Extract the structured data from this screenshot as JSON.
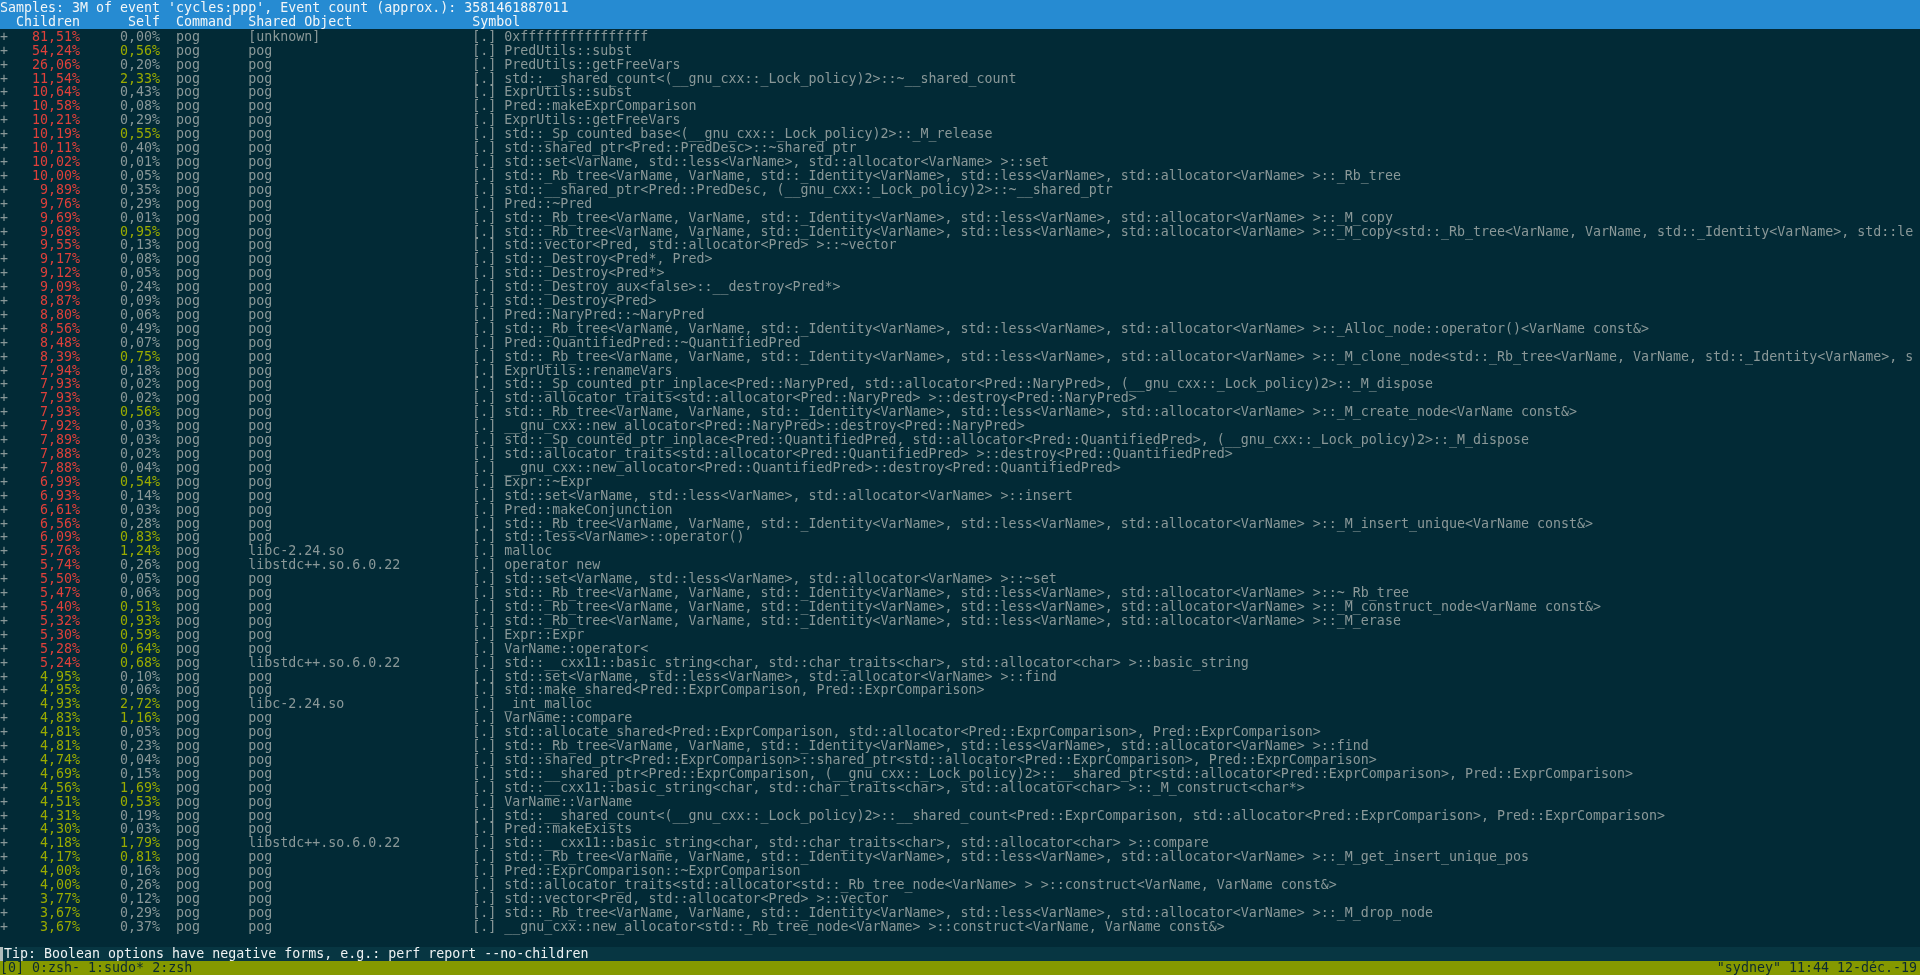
{
  "header": {
    "title": "Samples: 3M of event 'cycles:ppp', Event count (approx.): 3581461887011",
    "columns": [
      "Children",
      "Self",
      "Command",
      "Shared Object",
      "Symbol"
    ]
  },
  "rows": [
    {
      "toggle": "+",
      "children": {
        "text": "81,51%",
        "color": "#e0403a"
      },
      "self": {
        "text": "0,00%",
        "color": "#8a9898"
      },
      "command": "pog",
      "object": "[unknown]",
      "mode": "[.]",
      "symbol": "0xffffffffffffffff"
    },
    {
      "toggle": "+",
      "children": {
        "text": "54,24%",
        "color": "#e0403a"
      },
      "self": {
        "text": "0,56%",
        "color": "#9aab00"
      },
      "command": "pog",
      "object": "pog",
      "mode": "[.]",
      "symbol": "PredUtils::subst"
    },
    {
      "toggle": "+",
      "children": {
        "text": "26,06%",
        "color": "#e0403a"
      },
      "self": {
        "text": "0,20%",
        "color": "#8a9898"
      },
      "command": "pog",
      "object": "pog",
      "mode": "[.]",
      "symbol": "PredUtils::getFreeVars"
    },
    {
      "toggle": "+",
      "children": {
        "text": "11,54%",
        "color": "#e0403a"
      },
      "self": {
        "text": "2,33%",
        "color": "#9aab00"
      },
      "command": "pog",
      "object": "pog",
      "mode": "[.]",
      "symbol": "std::__shared_count<(__gnu_cxx::_Lock_policy)2>::~__shared_count"
    },
    {
      "toggle": "+",
      "children": {
        "text": "10,64%",
        "color": "#e0403a"
      },
      "self": {
        "text": "0,43%",
        "color": "#8a9898"
      },
      "command": "pog",
      "object": "pog",
      "mode": "[.]",
      "symbol": "ExprUtils::subst"
    },
    {
      "toggle": "+",
      "children": {
        "text": "10,58%",
        "color": "#e0403a"
      },
      "self": {
        "text": "0,08%",
        "color": "#8a9898"
      },
      "command": "pog",
      "object": "pog",
      "mode": "[.]",
      "symbol": "Pred::makeExprComparison"
    },
    {
      "toggle": "+",
      "children": {
        "text": "10,21%",
        "color": "#e0403a"
      },
      "self": {
        "text": "0,29%",
        "color": "#8a9898"
      },
      "command": "pog",
      "object": "pog",
      "mode": "[.]",
      "symbol": "ExprUtils::getFreeVars"
    },
    {
      "toggle": "+",
      "children": {
        "text": "10,19%",
        "color": "#e0403a"
      },
      "self": {
        "text": "0,55%",
        "color": "#9aab00"
      },
      "command": "pog",
      "object": "pog",
      "mode": "[.]",
      "symbol": "std::_Sp_counted_base<(__gnu_cxx::_Lock_policy)2>::_M_release"
    },
    {
      "toggle": "+",
      "children": {
        "text": "10,11%",
        "color": "#e0403a"
      },
      "self": {
        "text": "0,40%",
        "color": "#8a9898"
      },
      "command": "pog",
      "object": "pog",
      "mode": "[.]",
      "symbol": "std::shared_ptr<Pred::PredDesc>::~shared_ptr"
    },
    {
      "toggle": "+",
      "children": {
        "text": "10,02%",
        "color": "#e0403a"
      },
      "self": {
        "text": "0,01%",
        "color": "#8a9898"
      },
      "command": "pog",
      "object": "pog",
      "mode": "[.]",
      "symbol": "std::set<VarName, std::less<VarName>, std::allocator<VarName> >::set"
    },
    {
      "toggle": "+",
      "children": {
        "text": "10,00%",
        "color": "#e0403a"
      },
      "self": {
        "text": "0,05%",
        "color": "#8a9898"
      },
      "command": "pog",
      "object": "pog",
      "mode": "[.]",
      "symbol": "std::_Rb_tree<VarName, VarName, std::_Identity<VarName>, std::less<VarName>, std::allocator<VarName> >::_Rb_tree"
    },
    {
      "toggle": "+",
      "children": {
        "text": "9,89%",
        "color": "#e0403a"
      },
      "self": {
        "text": "0,35%",
        "color": "#8a9898"
      },
      "command": "pog",
      "object": "pog",
      "mode": "[.]",
      "symbol": "std::__shared_ptr<Pred::PredDesc, (__gnu_cxx::_Lock_policy)2>::~__shared_ptr"
    },
    {
      "toggle": "+",
      "children": {
        "text": "9,76%",
        "color": "#e0403a"
      },
      "self": {
        "text": "0,29%",
        "color": "#8a9898"
      },
      "command": "pog",
      "object": "pog",
      "mode": "[.]",
      "symbol": "Pred::~Pred"
    },
    {
      "toggle": "+",
      "children": {
        "text": "9,69%",
        "color": "#e0403a"
      },
      "self": {
        "text": "0,01%",
        "color": "#8a9898"
      },
      "command": "pog",
      "object": "pog",
      "mode": "[.]",
      "symbol": "std::_Rb_tree<VarName, VarName, std::_Identity<VarName>, std::less<VarName>, std::allocator<VarName> >::_M_copy"
    },
    {
      "toggle": "+",
      "children": {
        "text": "9,68%",
        "color": "#e0403a"
      },
      "self": {
        "text": "0,95%",
        "color": "#9aab00"
      },
      "command": "pog",
      "object": "pog",
      "mode": "[.]",
      "symbol": "std::_Rb_tree<VarName, VarName, std::_Identity<VarName>, std::less<VarName>, std::allocator<VarName> >::_M_copy<std::_Rb_tree<VarName, VarName, std::_Identity<VarName>, std::le"
    },
    {
      "toggle": "+",
      "children": {
        "text": "9,55%",
        "color": "#e0403a"
      },
      "self": {
        "text": "0,13%",
        "color": "#8a9898"
      },
      "command": "pog",
      "object": "pog",
      "mode": "[.]",
      "symbol": "std::vector<Pred, std::allocator<Pred> >::~vector"
    },
    {
      "toggle": "+",
      "children": {
        "text": "9,17%",
        "color": "#e0403a"
      },
      "self": {
        "text": "0,08%",
        "color": "#8a9898"
      },
      "command": "pog",
      "object": "pog",
      "mode": "[.]",
      "symbol": "std::_Destroy<Pred*, Pred>"
    },
    {
      "toggle": "+",
      "children": {
        "text": "9,12%",
        "color": "#e0403a"
      },
      "self": {
        "text": "0,05%",
        "color": "#8a9898"
      },
      "command": "pog",
      "object": "pog",
      "mode": "[.]",
      "symbol": "std::_Destroy<Pred*>"
    },
    {
      "toggle": "+",
      "children": {
        "text": "9,09%",
        "color": "#e0403a"
      },
      "self": {
        "text": "0,24%",
        "color": "#8a9898"
      },
      "command": "pog",
      "object": "pog",
      "mode": "[.]",
      "symbol": "std::_Destroy_aux<false>::__destroy<Pred*>"
    },
    {
      "toggle": "+",
      "children": {
        "text": "8,87%",
        "color": "#e0403a"
      },
      "self": {
        "text": "0,09%",
        "color": "#8a9898"
      },
      "command": "pog",
      "object": "pog",
      "mode": "[.]",
      "symbol": "std::_Destroy<Pred>"
    },
    {
      "toggle": "+",
      "children": {
        "text": "8,80%",
        "color": "#e0403a"
      },
      "self": {
        "text": "0,06%",
        "color": "#8a9898"
      },
      "command": "pog",
      "object": "pog",
      "mode": "[.]",
      "symbol": "Pred::NaryPred::~NaryPred"
    },
    {
      "toggle": "+",
      "children": {
        "text": "8,56%",
        "color": "#e0403a"
      },
      "self": {
        "text": "0,49%",
        "color": "#8a9898"
      },
      "command": "pog",
      "object": "pog",
      "mode": "[.]",
      "symbol": "std::_Rb_tree<VarName, VarName, std::_Identity<VarName>, std::less<VarName>, std::allocator<VarName> >::_Alloc_node::operator()<VarName const&>"
    },
    {
      "toggle": "+",
      "children": {
        "text": "8,48%",
        "color": "#e0403a"
      },
      "self": {
        "text": "0,07%",
        "color": "#8a9898"
      },
      "command": "pog",
      "object": "pog",
      "mode": "[.]",
      "symbol": "Pred::QuantifiedPred::~QuantifiedPred"
    },
    {
      "toggle": "+",
      "children": {
        "text": "8,39%",
        "color": "#e0403a"
      },
      "self": {
        "text": "0,75%",
        "color": "#9aab00"
      },
      "command": "pog",
      "object": "pog",
      "mode": "[.]",
      "symbol": "std::_Rb_tree<VarName, VarName, std::_Identity<VarName>, std::less<VarName>, std::allocator<VarName> >::_M_clone_node<std::_Rb_tree<VarName, VarName, std::_Identity<VarName>, s"
    },
    {
      "toggle": "+",
      "children": {
        "text": "7,94%",
        "color": "#e0403a"
      },
      "self": {
        "text": "0,18%",
        "color": "#8a9898"
      },
      "command": "pog",
      "object": "pog",
      "mode": "[.]",
      "symbol": "ExprUtils::renameVars"
    },
    {
      "toggle": "+",
      "children": {
        "text": "7,93%",
        "color": "#e0403a"
      },
      "self": {
        "text": "0,02%",
        "color": "#8a9898"
      },
      "command": "pog",
      "object": "pog",
      "mode": "[.]",
      "symbol": "std::_Sp_counted_ptr_inplace<Pred::NaryPred, std::allocator<Pred::NaryPred>, (__gnu_cxx::_Lock_policy)2>::_M_dispose"
    },
    {
      "toggle": "+",
      "children": {
        "text": "7,93%",
        "color": "#e0403a"
      },
      "self": {
        "text": "0,02%",
        "color": "#8a9898"
      },
      "command": "pog",
      "object": "pog",
      "mode": "[.]",
      "symbol": "std::allocator_traits<std::allocator<Pred::NaryPred> >::destroy<Pred::NaryPred>"
    },
    {
      "toggle": "+",
      "children": {
        "text": "7,93%",
        "color": "#e0403a"
      },
      "self": {
        "text": "0,56%",
        "color": "#9aab00"
      },
      "command": "pog",
      "object": "pog",
      "mode": "[.]",
      "symbol": "std::_Rb_tree<VarName, VarName, std::_Identity<VarName>, std::less<VarName>, std::allocator<VarName> >::_M_create_node<VarName const&>"
    },
    {
      "toggle": "+",
      "children": {
        "text": "7,92%",
        "color": "#e0403a"
      },
      "self": {
        "text": "0,03%",
        "color": "#8a9898"
      },
      "command": "pog",
      "object": "pog",
      "mode": "[.]",
      "symbol": "__gnu_cxx::new_allocator<Pred::NaryPred>::destroy<Pred::NaryPred>"
    },
    {
      "toggle": "+",
      "children": {
        "text": "7,89%",
        "color": "#e0403a"
      },
      "self": {
        "text": "0,03%",
        "color": "#8a9898"
      },
      "command": "pog",
      "object": "pog",
      "mode": "[.]",
      "symbol": "std::_Sp_counted_ptr_inplace<Pred::QuantifiedPred, std::allocator<Pred::QuantifiedPred>, (__gnu_cxx::_Lock_policy)2>::_M_dispose"
    },
    {
      "toggle": "+",
      "children": {
        "text": "7,88%",
        "color": "#e0403a"
      },
      "self": {
        "text": "0,02%",
        "color": "#8a9898"
      },
      "command": "pog",
      "object": "pog",
      "mode": "[.]",
      "symbol": "std::allocator_traits<std::allocator<Pred::QuantifiedPred> >::destroy<Pred::QuantifiedPred>"
    },
    {
      "toggle": "+",
      "children": {
        "text": "7,88%",
        "color": "#e0403a"
      },
      "self": {
        "text": "0,04%",
        "color": "#8a9898"
      },
      "command": "pog",
      "object": "pog",
      "mode": "[.]",
      "symbol": "__gnu_cxx::new_allocator<Pred::QuantifiedPred>::destroy<Pred::QuantifiedPred>"
    },
    {
      "toggle": "+",
      "children": {
        "text": "6,99%",
        "color": "#e0403a"
      },
      "self": {
        "text": "0,54%",
        "color": "#9aab00"
      },
      "command": "pog",
      "object": "pog",
      "mode": "[.]",
      "symbol": "Expr::~Expr"
    },
    {
      "toggle": "+",
      "children": {
        "text": "6,93%",
        "color": "#e0403a"
      },
      "self": {
        "text": "0,14%",
        "color": "#8a9898"
      },
      "command": "pog",
      "object": "pog",
      "mode": "[.]",
      "symbol": "std::set<VarName, std::less<VarName>, std::allocator<VarName> >::insert"
    },
    {
      "toggle": "+",
      "children": {
        "text": "6,61%",
        "color": "#e0403a"
      },
      "self": {
        "text": "0,03%",
        "color": "#8a9898"
      },
      "command": "pog",
      "object": "pog",
      "mode": "[.]",
      "symbol": "Pred::makeConjunction"
    },
    {
      "toggle": "+",
      "children": {
        "text": "6,56%",
        "color": "#e0403a"
      },
      "self": {
        "text": "0,28%",
        "color": "#8a9898"
      },
      "command": "pog",
      "object": "pog",
      "mode": "[.]",
      "symbol": "std::_Rb_tree<VarName, VarName, std::_Identity<VarName>, std::less<VarName>, std::allocator<VarName> >::_M_insert_unique<VarName const&>"
    },
    {
      "toggle": "+",
      "children": {
        "text": "6,09%",
        "color": "#e0403a"
      },
      "self": {
        "text": "0,83%",
        "color": "#9aab00"
      },
      "command": "pog",
      "object": "pog",
      "mode": "[.]",
      "symbol": "std::less<VarName>::operator()"
    },
    {
      "toggle": "+",
      "children": {
        "text": "5,76%",
        "color": "#e0403a"
      },
      "self": {
        "text": "1,24%",
        "color": "#9aab00"
      },
      "command": "pog",
      "object": "libc-2.24.so",
      "mode": "[.]",
      "symbol": "malloc"
    },
    {
      "toggle": "+",
      "children": {
        "text": "5,74%",
        "color": "#e0403a"
      },
      "self": {
        "text": "0,26%",
        "color": "#8a9898"
      },
      "command": "pog",
      "object": "libstdc++.so.6.0.22",
      "mode": "[.]",
      "symbol": "operator new"
    },
    {
      "toggle": "+",
      "children": {
        "text": "5,50%",
        "color": "#e0403a"
      },
      "self": {
        "text": "0,05%",
        "color": "#8a9898"
      },
      "command": "pog",
      "object": "pog",
      "mode": "[.]",
      "symbol": "std::set<VarName, std::less<VarName>, std::allocator<VarName> >::~set"
    },
    {
      "toggle": "+",
      "children": {
        "text": "5,47%",
        "color": "#e0403a"
      },
      "self": {
        "text": "0,06%",
        "color": "#8a9898"
      },
      "command": "pog",
      "object": "pog",
      "mode": "[.]",
      "symbol": "std::_Rb_tree<VarName, VarName, std::_Identity<VarName>, std::less<VarName>, std::allocator<VarName> >::~_Rb_tree"
    },
    {
      "toggle": "+",
      "children": {
        "text": "5,40%",
        "color": "#e0403a"
      },
      "self": {
        "text": "0,51%",
        "color": "#9aab00"
      },
      "command": "pog",
      "object": "pog",
      "mode": "[.]",
      "symbol": "std::_Rb_tree<VarName, VarName, std::_Identity<VarName>, std::less<VarName>, std::allocator<VarName> >::_M_construct_node<VarName const&>"
    },
    {
      "toggle": "+",
      "children": {
        "text": "5,32%",
        "color": "#e0403a"
      },
      "self": {
        "text": "0,93%",
        "color": "#9aab00"
      },
      "command": "pog",
      "object": "pog",
      "mode": "[.]",
      "symbol": "std::_Rb_tree<VarName, VarName, std::_Identity<VarName>, std::less<VarName>, std::allocator<VarName> >::_M_erase"
    },
    {
      "toggle": "+",
      "children": {
        "text": "5,30%",
        "color": "#e0403a"
      },
      "self": {
        "text": "0,59%",
        "color": "#9aab00"
      },
      "command": "pog",
      "object": "pog",
      "mode": "[.]",
      "symbol": "Expr::Expr"
    },
    {
      "toggle": "+",
      "children": {
        "text": "5,28%",
        "color": "#e0403a"
      },
      "self": {
        "text": "0,64%",
        "color": "#9aab00"
      },
      "command": "pog",
      "object": "pog",
      "mode": "[.]",
      "symbol": "VarName::operator<"
    },
    {
      "toggle": "+",
      "children": {
        "text": "5,24%",
        "color": "#e0403a"
      },
      "self": {
        "text": "0,68%",
        "color": "#9aab00"
      },
      "command": "pog",
      "object": "libstdc++.so.6.0.22",
      "mode": "[.]",
      "symbol": "std::__cxx11::basic_string<char, std::char_traits<char>, std::allocator<char> >::basic_string"
    },
    {
      "toggle": "+",
      "children": {
        "text": "4,95%",
        "color": "#9aab00"
      },
      "self": {
        "text": "0,10%",
        "color": "#8a9898"
      },
      "command": "pog",
      "object": "pog",
      "mode": "[.]",
      "symbol": "std::set<VarName, std::less<VarName>, std::allocator<VarName> >::find"
    },
    {
      "toggle": "+",
      "children": {
        "text": "4,95%",
        "color": "#9aab00"
      },
      "self": {
        "text": "0,06%",
        "color": "#8a9898"
      },
      "command": "pog",
      "object": "pog",
      "mode": "[.]",
      "symbol": "std::make_shared<Pred::ExprComparison, Pred::ExprComparison>"
    },
    {
      "toggle": "+",
      "children": {
        "text": "4,93%",
        "color": "#9aab00"
      },
      "self": {
        "text": "2,72%",
        "color": "#9aab00"
      },
      "command": "pog",
      "object": "libc-2.24.so",
      "mode": "[.]",
      "symbol": "_int_malloc"
    },
    {
      "toggle": "+",
      "children": {
        "text": "4,83%",
        "color": "#9aab00"
      },
      "self": {
        "text": "1,16%",
        "color": "#9aab00"
      },
      "command": "pog",
      "object": "pog",
      "mode": "[.]",
      "symbol": "VarName::compare"
    },
    {
      "toggle": "+",
      "children": {
        "text": "4,81%",
        "color": "#9aab00"
      },
      "self": {
        "text": "0,05%",
        "color": "#8a9898"
      },
      "command": "pog",
      "object": "pog",
      "mode": "[.]",
      "symbol": "std::allocate_shared<Pred::ExprComparison, std::allocator<Pred::ExprComparison>, Pred::ExprComparison>"
    },
    {
      "toggle": "+",
      "children": {
        "text": "4,81%",
        "color": "#9aab00"
      },
      "self": {
        "text": "0,23%",
        "color": "#8a9898"
      },
      "command": "pog",
      "object": "pog",
      "mode": "[.]",
      "symbol": "std::_Rb_tree<VarName, VarName, std::_Identity<VarName>, std::less<VarName>, std::allocator<VarName> >::find"
    },
    {
      "toggle": "+",
      "children": {
        "text": "4,74%",
        "color": "#9aab00"
      },
      "self": {
        "text": "0,04%",
        "color": "#8a9898"
      },
      "command": "pog",
      "object": "pog",
      "mode": "[.]",
      "symbol": "std::shared_ptr<Pred::ExprComparison>::shared_ptr<std::allocator<Pred::ExprComparison>, Pred::ExprComparison>"
    },
    {
      "toggle": "+",
      "children": {
        "text": "4,69%",
        "color": "#9aab00"
      },
      "self": {
        "text": "0,15%",
        "color": "#8a9898"
      },
      "command": "pog",
      "object": "pog",
      "mode": "[.]",
      "symbol": "std::__shared_ptr<Pred::ExprComparison, (__gnu_cxx::_Lock_policy)2>::__shared_ptr<std::allocator<Pred::ExprComparison>, Pred::ExprComparison>"
    },
    {
      "toggle": "+",
      "children": {
        "text": "4,56%",
        "color": "#9aab00"
      },
      "self": {
        "text": "1,69%",
        "color": "#9aab00"
      },
      "command": "pog",
      "object": "pog",
      "mode": "[.]",
      "symbol": "std::__cxx11::basic_string<char, std::char_traits<char>, std::allocator<char> >::_M_construct<char*>"
    },
    {
      "toggle": "+",
      "children": {
        "text": "4,51%",
        "color": "#9aab00"
      },
      "self": {
        "text": "0,53%",
        "color": "#9aab00"
      },
      "command": "pog",
      "object": "pog",
      "mode": "[.]",
      "symbol": "VarName::VarName"
    },
    {
      "toggle": "+",
      "children": {
        "text": "4,31%",
        "color": "#9aab00"
      },
      "self": {
        "text": "0,19%",
        "color": "#8a9898"
      },
      "command": "pog",
      "object": "pog",
      "mode": "[.]",
      "symbol": "std::__shared_count<(__gnu_cxx::_Lock_policy)2>::__shared_count<Pred::ExprComparison, std::allocator<Pred::ExprComparison>, Pred::ExprComparison>"
    },
    {
      "toggle": "+",
      "children": {
        "text": "4,30%",
        "color": "#9aab00"
      },
      "self": {
        "text": "0,03%",
        "color": "#8a9898"
      },
      "command": "pog",
      "object": "pog",
      "mode": "[.]",
      "symbol": "Pred::makeExists"
    },
    {
      "toggle": "+",
      "children": {
        "text": "4,18%",
        "color": "#9aab00"
      },
      "self": {
        "text": "1,79%",
        "color": "#9aab00"
      },
      "command": "pog",
      "object": "libstdc++.so.6.0.22",
      "mode": "[.]",
      "symbol": "std::__cxx11::basic_string<char, std::char_traits<char>, std::allocator<char> >::compare"
    },
    {
      "toggle": "+",
      "children": {
        "text": "4,17%",
        "color": "#9aab00"
      },
      "self": {
        "text": "0,81%",
        "color": "#9aab00"
      },
      "command": "pog",
      "object": "pog",
      "mode": "[.]",
      "symbol": "std::_Rb_tree<VarName, VarName, std::_Identity<VarName>, std::less<VarName>, std::allocator<VarName> >::_M_get_insert_unique_pos"
    },
    {
      "toggle": "+",
      "children": {
        "text": "4,00%",
        "color": "#9aab00"
      },
      "self": {
        "text": "0,16%",
        "color": "#8a9898"
      },
      "command": "pog",
      "object": "pog",
      "mode": "[.]",
      "symbol": "Pred::ExprComparison::~ExprComparison"
    },
    {
      "toggle": "+",
      "children": {
        "text": "4,00%",
        "color": "#9aab00"
      },
      "self": {
        "text": "0,26%",
        "color": "#8a9898"
      },
      "command": "pog",
      "object": "pog",
      "mode": "[.]",
      "symbol": "std::allocator_traits<std::allocator<std::_Rb_tree_node<VarName> > >::construct<VarName, VarName const&>"
    },
    {
      "toggle": "+",
      "children": {
        "text": "3,77%",
        "color": "#9aab00"
      },
      "self": {
        "text": "0,12%",
        "color": "#8a9898"
      },
      "command": "pog",
      "object": "pog",
      "mode": "[.]",
      "symbol": "std::vector<Pred, std::allocator<Pred> >::vector"
    },
    {
      "toggle": "+",
      "children": {
        "text": "3,67%",
        "color": "#9aab00"
      },
      "self": {
        "text": "0,29%",
        "color": "#8a9898"
      },
      "command": "pog",
      "object": "pog",
      "mode": "[.]",
      "symbol": "std::_Rb_tree<VarName, VarName, std::_Identity<VarName>, std::less<VarName>, std::allocator<VarName> >::_M_drop_node"
    },
    {
      "toggle": "+",
      "children": {
        "text": "3,67%",
        "color": "#9aab00"
      },
      "self": {
        "text": "0,37%",
        "color": "#8a9898"
      },
      "command": "pog",
      "object": "pog",
      "mode": "[.]",
      "symbol": "__gnu_cxx::new_allocator<std::_Rb_tree_node<VarName> >::construct<VarName, VarName const&>"
    }
  ],
  "tip": {
    "text": "Tip: Boolean options have negative forms, e.g.: perf report --no-children",
    "cursor": true
  },
  "status_bar": {
    "session": "[0]",
    "windows": [
      "0:zsh-",
      "1:sudo*",
      "2:zsh"
    ],
    "right": "\"sydney\" 11:44 12-déc.-19"
  }
}
